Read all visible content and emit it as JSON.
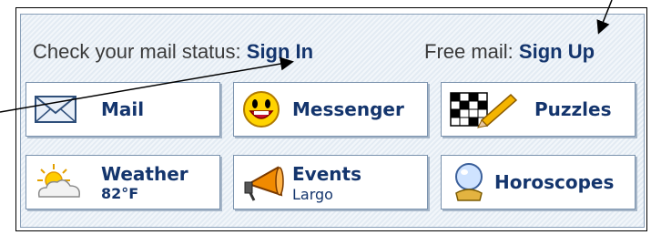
{
  "status_row": {
    "check_text": "Check your mail status:",
    "sign_in": "Sign In",
    "free_text": "Free mail:",
    "sign_up": "Sign Up"
  },
  "tiles": {
    "mail": {
      "label": "Mail",
      "icon": "envelope-icon"
    },
    "messenger": {
      "label": "Messenger",
      "icon": "smiley-icon"
    },
    "puzzles": {
      "label": "Puzzles",
      "icon": "crossword-pencil-icon"
    },
    "weather": {
      "label": "Weather",
      "value": "82°F",
      "icon": "sun-cloud-icon"
    },
    "events": {
      "label": "Events",
      "location": "Largo",
      "icon": "megaphone-icon"
    },
    "horoscopes": {
      "label": "Horoscopes",
      "icon": "crystal-ball-icon"
    }
  },
  "colors": {
    "link": "#14356d",
    "tile_border": "#7a92ad",
    "panel_border": "#8aa0b8"
  }
}
